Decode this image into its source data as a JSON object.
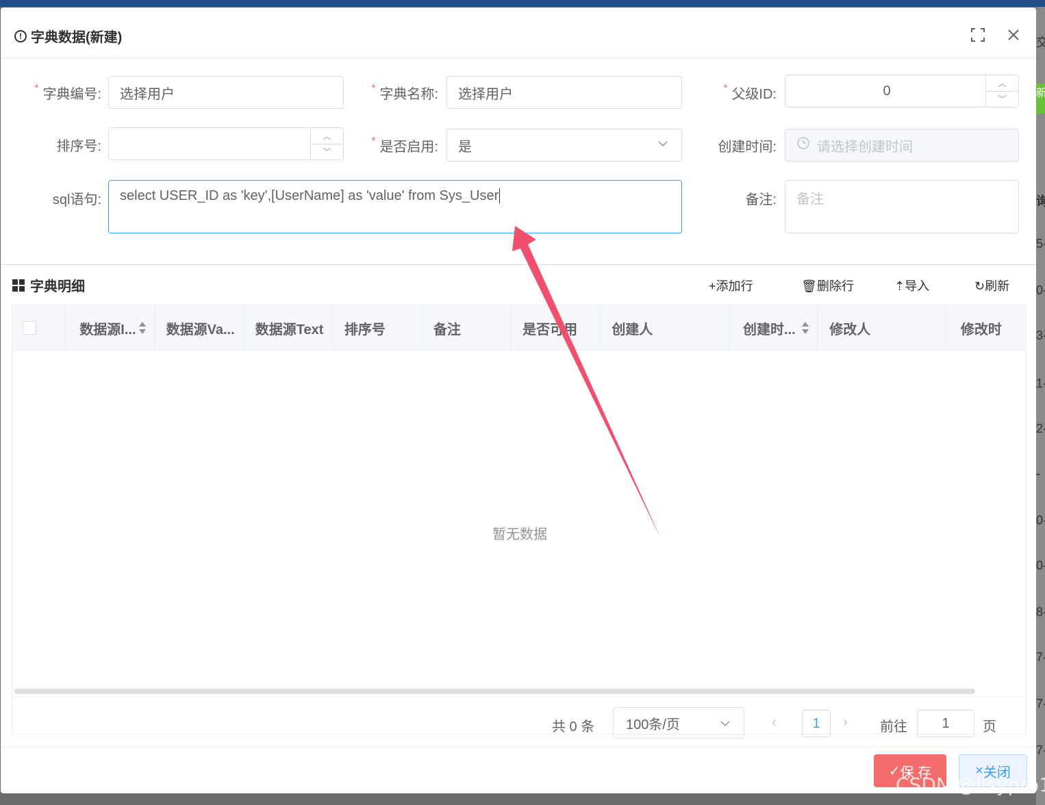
{
  "dialog": {
    "title": "字典数据(新建)"
  },
  "form": {
    "dic_no": {
      "label": "字典编号:",
      "value": "选择用户"
    },
    "dic_name": {
      "label": "字典名称:",
      "value": "选择用户"
    },
    "parent_id": {
      "label": "父级ID:",
      "value": "0"
    },
    "order_no": {
      "label": "排序号:",
      "value": ""
    },
    "enable": {
      "label": "是否启用:",
      "value": "是"
    },
    "create_date": {
      "label": "创建时间:",
      "placeholder": "请选择创建时间"
    },
    "sql": {
      "label": "sql语句:",
      "value": "select USER_ID as 'key',[UserName] as 'value' from Sys_User"
    },
    "remark": {
      "label": "备注:",
      "placeholder": "备注"
    }
  },
  "detail": {
    "title": "字典明细",
    "toolbar": {
      "add": "+添加行",
      "delete": "删除行",
      "import": "导入",
      "refresh": "刷新"
    },
    "columns": [
      "数据源I...",
      "数据源Va...",
      "数据源Text",
      "排序号",
      "备注",
      "是否可用",
      "创建人",
      "创建时...",
      "修改人",
      "修改时"
    ],
    "empty_text": "暂无数据",
    "pager": {
      "total": "共 0 条",
      "page_size": "100条/页",
      "current": "1",
      "goto_label": "前往",
      "goto_value": "1",
      "page_unit": "页"
    }
  },
  "footer": {
    "save": "保 存",
    "close": "关闭"
  },
  "background": {
    "right_fragments": [
      "交",
      "新",
      "询",
      "5-",
      "0-",
      "3-",
      "1-",
      "2-",
      "-",
      "0-",
      "0-",
      "8-",
      "7-",
      "7-",
      "7-"
    ]
  },
  "watermark": "CSDN @lisypro1",
  "colors": {
    "primary": "#409eff",
    "danger": "#f56c6c",
    "success": "#67c23a",
    "arrow": "#f0506e"
  }
}
